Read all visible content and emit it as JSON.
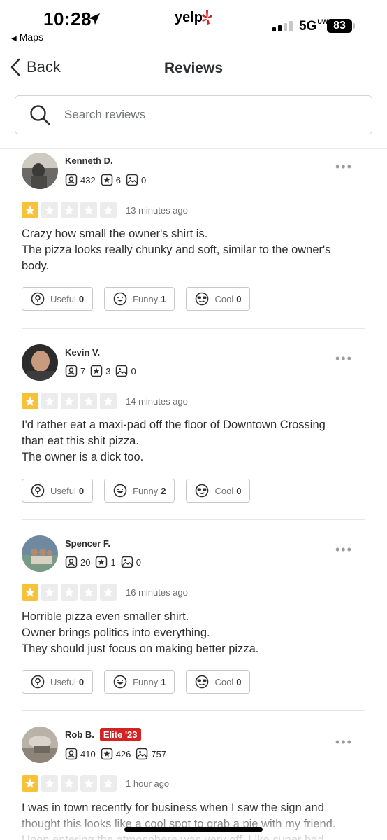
{
  "status_bar": {
    "time": "10:28",
    "back_app": "Maps",
    "brand": "yelp",
    "network": "5G",
    "network_suffix": "UW",
    "battery": "83"
  },
  "header": {
    "back_label": "Back",
    "title": "Reviews"
  },
  "search": {
    "placeholder": "Search reviews"
  },
  "colors": {
    "star_on": "#f7c13a",
    "star_off": "#ececec",
    "elite": "#d32323"
  },
  "reviews": [
    {
      "name": "Kenneth D.",
      "elite": "",
      "friends": "432",
      "review_count": "6",
      "photos": "0",
      "rating": 1,
      "time_ago": "13 minutes ago",
      "text": [
        "Crazy how small the owner's shirt is.",
        "The pizza looks really chunky and soft, similar to the owner's",
        "body."
      ],
      "useful": "0",
      "funny": "1",
      "cool": "0"
    },
    {
      "name": "Kevin V.",
      "elite": "",
      "friends": "7",
      "review_count": "3",
      "photos": "0",
      "rating": 1,
      "time_ago": "14 minutes ago",
      "text": [
        "I'd rather eat a maxi-pad off the floor of Downtown Crossing",
        "than eat this shit pizza.",
        "The owner is a dick too."
      ],
      "useful": "0",
      "funny": "2",
      "cool": "0"
    },
    {
      "name": "Spencer F.",
      "elite": "",
      "friends": "20",
      "review_count": "1",
      "photos": "0",
      "rating": 1,
      "time_ago": "16 minutes ago",
      "text": [
        "Horrible pizza even smaller shirt.",
        "Owner brings politics into everything.",
        "They should just focus on making better pizza."
      ],
      "useful": "0",
      "funny": "1",
      "cool": "0"
    },
    {
      "name": "Rob B.",
      "elite": "Elite '23",
      "friends": "410",
      "review_count": "426",
      "photos": "757",
      "rating": 1,
      "time_ago": "1 hour ago",
      "text": [
        "I was in town recently for business when I saw the sign and",
        "thought this looks like a cool spot to grab a pie with my friend.",
        "Upon entering the atmosphere was very off. Like super bad"
      ],
      "useful": "",
      "funny": "",
      "cool": ""
    }
  ],
  "labels": {
    "useful": "Useful",
    "funny": "Funny",
    "cool": "Cool"
  }
}
